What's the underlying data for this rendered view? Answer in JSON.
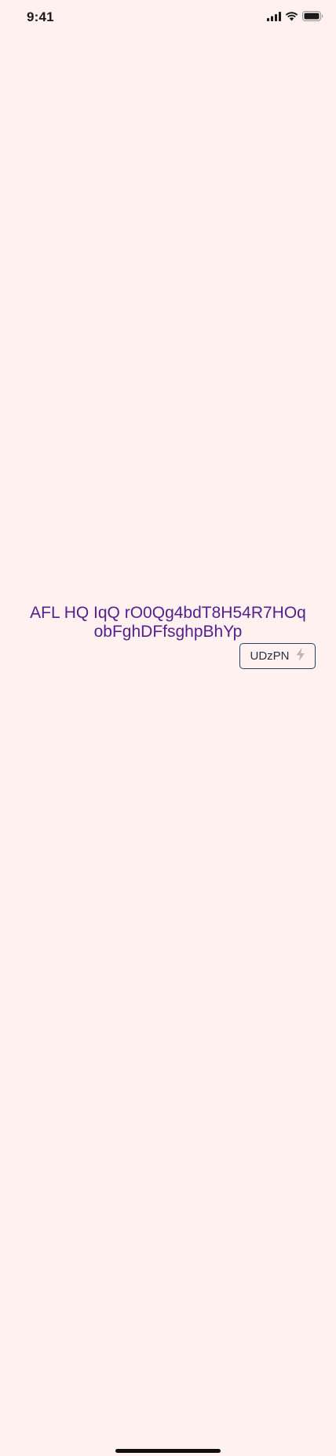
{
  "status_bar": {
    "time": "9:41",
    "icons": [
      "cellular-signal-icon",
      "wifi-icon",
      "battery-icon"
    ]
  },
  "main": {
    "headline": "AFL HQ IqQ rO0Qg4bdT8H54R7HOq obFghDFfsghpBhYp",
    "button": {
      "label": "UDzPN",
      "icon": "lightning-bolt-icon"
    }
  },
  "colors": {
    "background": "#fff1f0",
    "headline": "#55208c",
    "button_border": "#234163",
    "button_text": "#2a3340",
    "icon_muted": "#b8b8bc"
  }
}
